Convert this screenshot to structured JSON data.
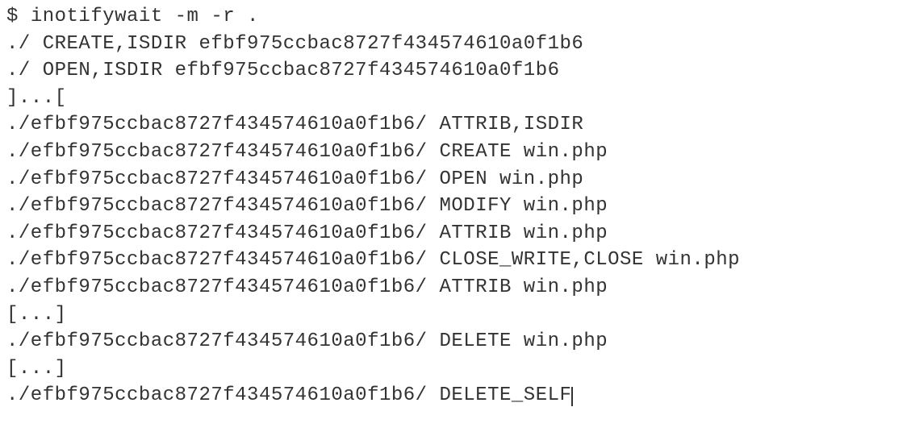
{
  "terminal": {
    "prompt": "$ ",
    "command": "inotifywait -m -r .",
    "lines": [
      "./ CREATE,ISDIR efbf975ccbac8727f434574610a0f1b6",
      "./ OPEN,ISDIR efbf975ccbac8727f434574610a0f1b6",
      "]...[",
      "./efbf975ccbac8727f434574610a0f1b6/ ATTRIB,ISDIR",
      "./efbf975ccbac8727f434574610a0f1b6/ CREATE win.php",
      "./efbf975ccbac8727f434574610a0f1b6/ OPEN win.php",
      "./efbf975ccbac8727f434574610a0f1b6/ MODIFY win.php",
      "./efbf975ccbac8727f434574610a0f1b6/ ATTRIB win.php",
      "./efbf975ccbac8727f434574610a0f1b6/ CLOSE_WRITE,CLOSE win.php",
      "./efbf975ccbac8727f434574610a0f1b6/ ATTRIB win.php",
      "[...]",
      "./efbf975ccbac8727f434574610a0f1b6/ DELETE win.php",
      "[...]",
      "./efbf975ccbac8727f434574610a0f1b6/ DELETE_SELF"
    ]
  }
}
